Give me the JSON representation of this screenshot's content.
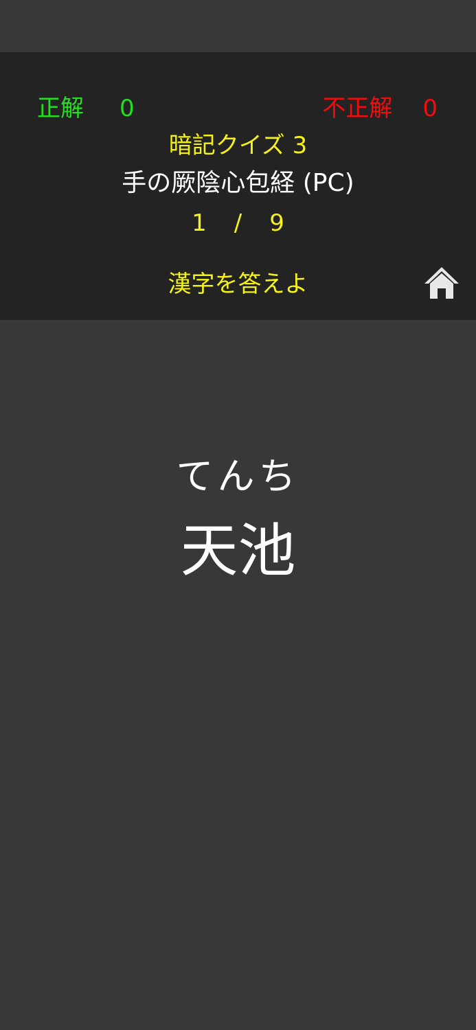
{
  "score": {
    "correct_label": "正解",
    "correct_value": "0",
    "wrong_label": "不正解",
    "wrong_value": "0"
  },
  "quiz": {
    "title": "暗記クイズ 3",
    "subtitle": "手の厥陰心包経 (PC)",
    "progress_current": "1",
    "progress_separator": "/",
    "progress_total": "9",
    "instruction": "漢字を答えよ"
  },
  "card": {
    "reading": "てんち",
    "answer": "天池"
  },
  "icons": {
    "home": "home-icon"
  },
  "colors": {
    "correct": "#22e01e",
    "wrong": "#f20c0c",
    "accent": "#f5f21a",
    "header_bg": "#232323",
    "page_bg": "#383838"
  }
}
